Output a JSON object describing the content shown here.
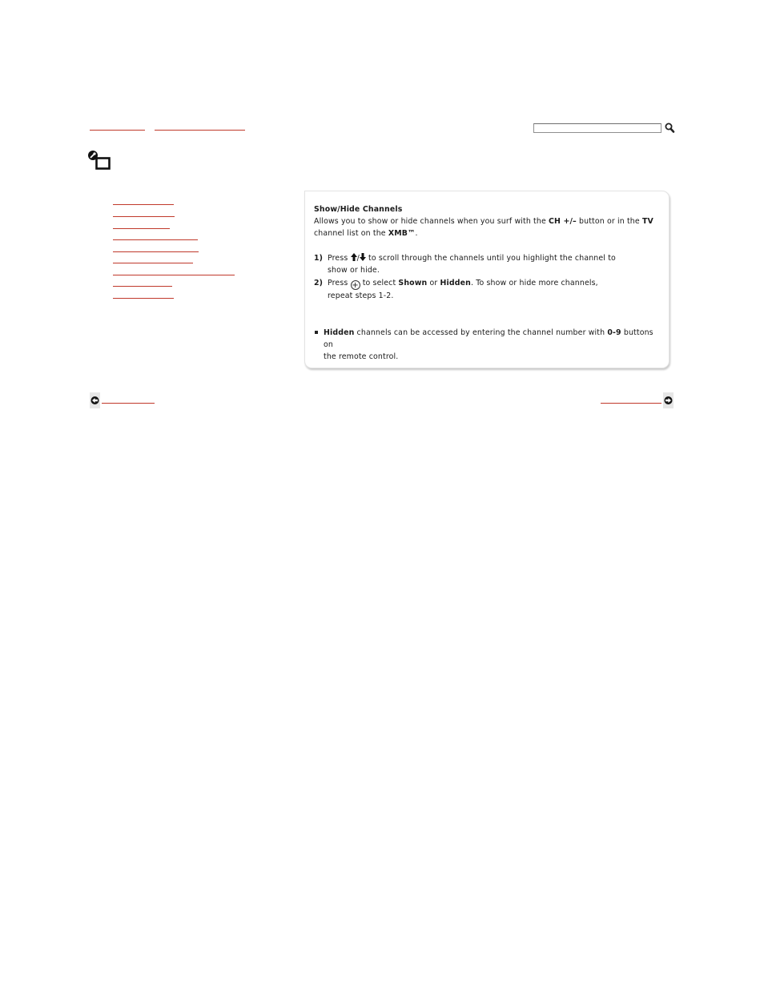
{
  "search": {
    "placeholder": ""
  },
  "panel": {
    "title": "Show/Hide Channels",
    "desc": {
      "t1": "Allows you to show or hide channels when you surf with the ",
      "k_ch": "CH +/–",
      "t2": " button or in the ",
      "k_tv": "TV",
      "t3": "channel list on the ",
      "k_xmb": "XMB™",
      "t4": "."
    },
    "steps": [
      {
        "num": "1)",
        "a": "Press ",
        "arrows": "/",
        "b": " to scroll through the channels until you highlight the channel to",
        "c": "show or hide."
      },
      {
        "num": "2)",
        "a": "Press ",
        "plus": "+",
        "b": " to select ",
        "k_shown": "Shown",
        "or": " or ",
        "k_hidden": "Hidden",
        "c": ". To show or hide more channels,",
        "d": "repeat steps 1-2."
      }
    ],
    "note": {
      "k_hidden": "Hidden",
      "a": " channels can be accessed by entering the channel number with ",
      "k_digits": "0-9",
      "b": " buttons on",
      "c": "the remote control."
    }
  },
  "colors": {
    "link": "#c0392b",
    "panel_border": "#e3e3e3"
  },
  "icons": {
    "settings": "settings-icon",
    "search": "search-icon",
    "prev": "prev-arrow-icon",
    "next": "next-arrow-icon"
  }
}
